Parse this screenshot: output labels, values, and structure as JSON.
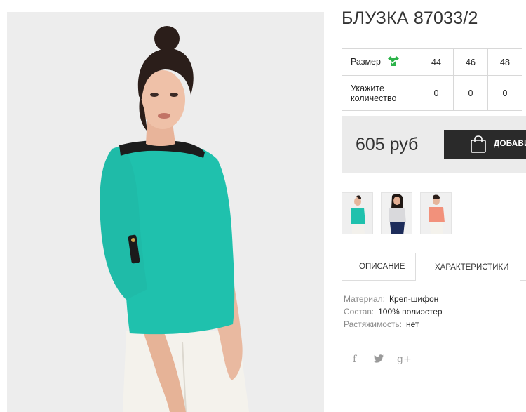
{
  "product": {
    "title": "БЛУЗКА 87033/2",
    "price": "605 руб",
    "add_button_label": "ДОБАВИТЬ"
  },
  "size_table": {
    "size_label": "Размер",
    "qty_label_line1": "Укажите",
    "qty_label_line2": "количество",
    "sizes": [
      "44",
      "46",
      "48"
    ],
    "quantities": [
      "0",
      "0",
      "0"
    ]
  },
  "thumbnails": [
    {
      "name": "turquoise-blouse"
    },
    {
      "name": "grey-blouse"
    },
    {
      "name": "coral-blouse"
    }
  ],
  "tabs": {
    "description": "ОПИСАНИЕ",
    "characteristics": "ХАРАКТЕРИСТИКИ",
    "active": "characteristics"
  },
  "specs": [
    {
      "key": "Материал:",
      "value": "Креп-шифон"
    },
    {
      "key": "Состав:",
      "value": "100% полиэстер"
    },
    {
      "key": "Растяжимость:",
      "value": "нет"
    }
  ],
  "social": {
    "facebook": "f",
    "twitter": "twitter-icon",
    "google_plus": "g+"
  },
  "colors": {
    "blouse": "#1fc1ad",
    "button_bg": "#2a2a2a",
    "price_bg": "#ebebeb",
    "size_icon": "#2db34a"
  }
}
